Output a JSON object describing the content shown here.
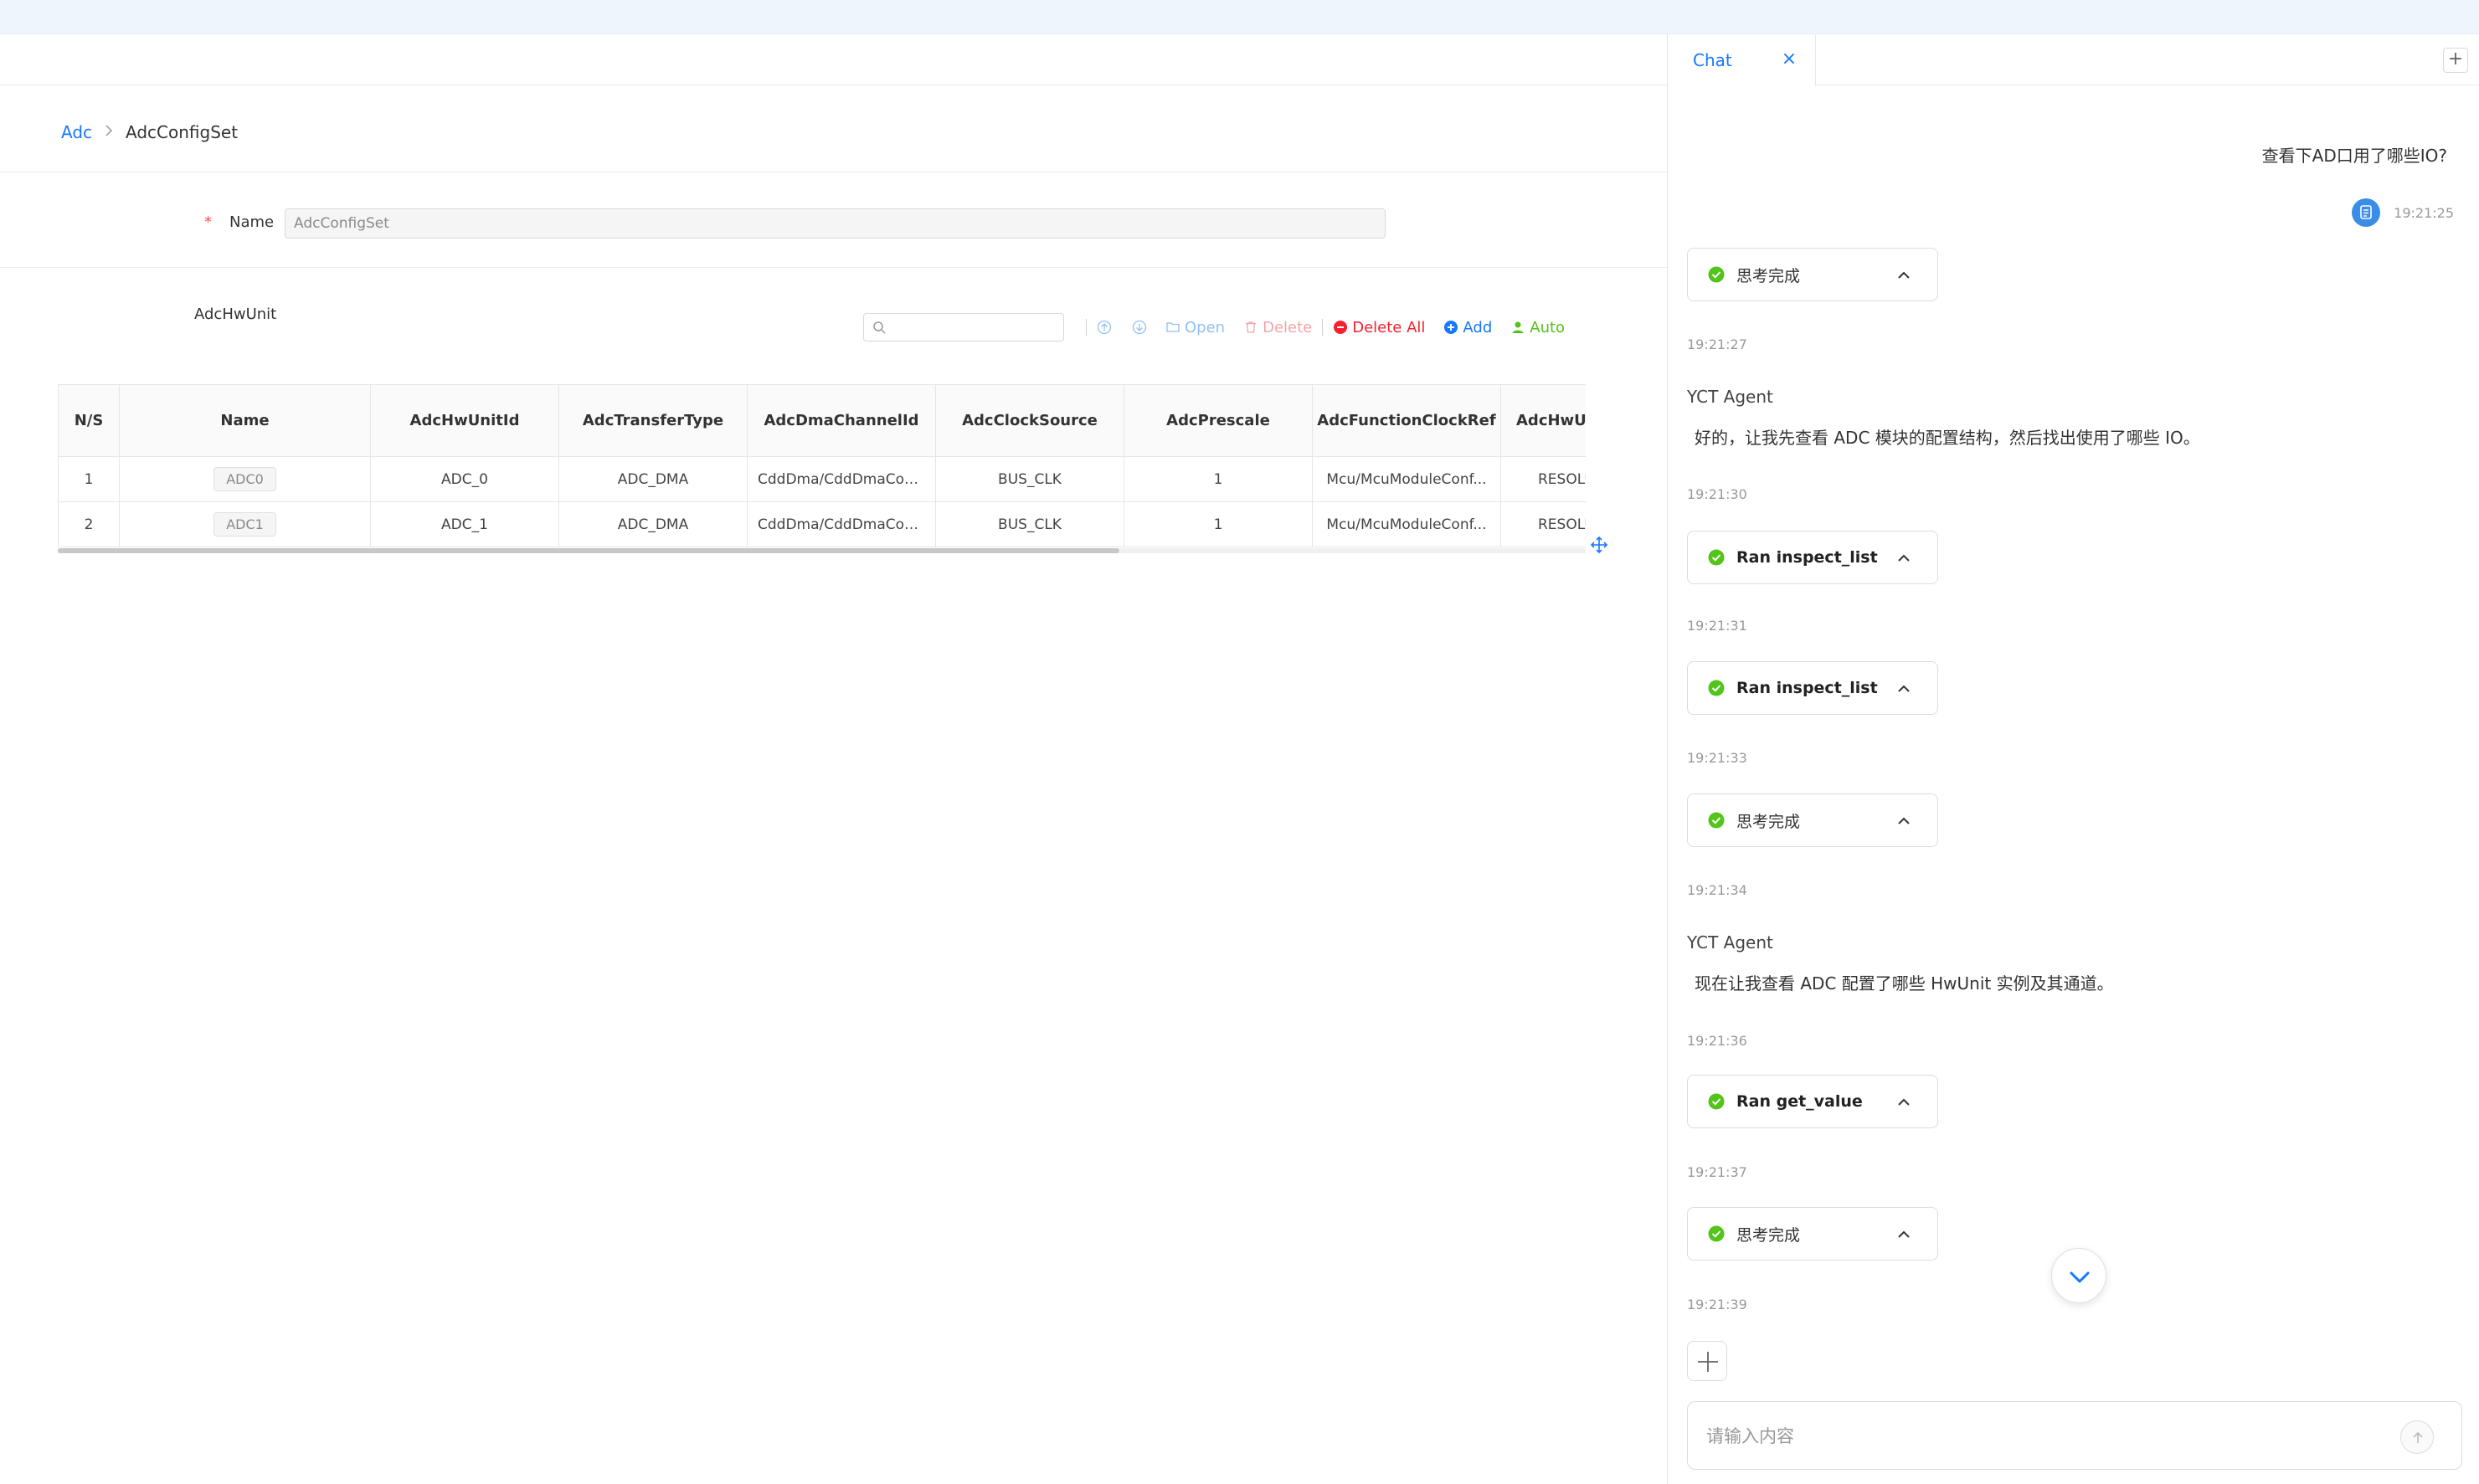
{
  "breadcrumb": {
    "parent": "Adc",
    "current": "AdcConfigSet"
  },
  "form": {
    "name_label": "Name",
    "name_required_mark": "*",
    "name_value": "AdcConfigSet"
  },
  "section": {
    "title": "AdcHwUnit"
  },
  "toolbar": {
    "search_placeholder": "",
    "open_label": "Open",
    "delete_label": "Delete",
    "delete_all_label": "Delete All",
    "add_label": "Add",
    "auto_label": "Auto"
  },
  "table": {
    "columns": [
      "N/S",
      "Name",
      "AdcHwUnitId",
      "AdcTransferType",
      "AdcDmaChannelId",
      "AdcClockSource",
      "AdcPrescale",
      "AdcFunctionClockRef",
      "AdcHwUnitResolution"
    ],
    "rows": [
      [
        "1",
        "ADC0",
        "ADC_0",
        "ADC_DMA",
        "CddDma/CddDmaCon...",
        "BUS_CLK",
        "1",
        "Mcu/McuModuleConf...",
        "RESOLUTION"
      ],
      [
        "2",
        "ADC1",
        "ADC_1",
        "ADC_DMA",
        "CddDma/CddDmaCon...",
        "BUS_CLK",
        "1",
        "Mcu/McuModuleConf...",
        "RESOLUTION"
      ]
    ]
  },
  "chat": {
    "tab_label": "Chat",
    "close_glyph": "×",
    "add_glyph": "+",
    "user_message": "查看下AD口用了哪些IO?",
    "user_time": "19:21:25",
    "agent_name": "YCT Agent",
    "items": [
      {
        "status": "思考完成",
        "time": "19:21:27"
      },
      {
        "text": "好的，让我先查看 ADC 模块的配置结构，然后找出使用了哪些 IO。",
        "time": "19:21:30"
      },
      {
        "status": "Ran inspect_list",
        "time": "19:21:31"
      },
      {
        "status": "Ran inspect_list",
        "time": "19:21:33"
      },
      {
        "status": "思考完成",
        "time": "19:21:34"
      },
      {
        "text": "现在让我查看 ADC 配置了哪些 HwUnit 实例及其通道。",
        "time": "19:21:36"
      },
      {
        "status": "Ran get_value",
        "time": "19:21:37"
      },
      {
        "status": "思考完成",
        "time": "19:21:39"
      }
    ],
    "input_placeholder": "请输入内容"
  },
  "colors": {
    "accent": "#1677ff",
    "success": "#52c41a",
    "danger": "#f5222d",
    "topbar": "#eef5fd"
  }
}
